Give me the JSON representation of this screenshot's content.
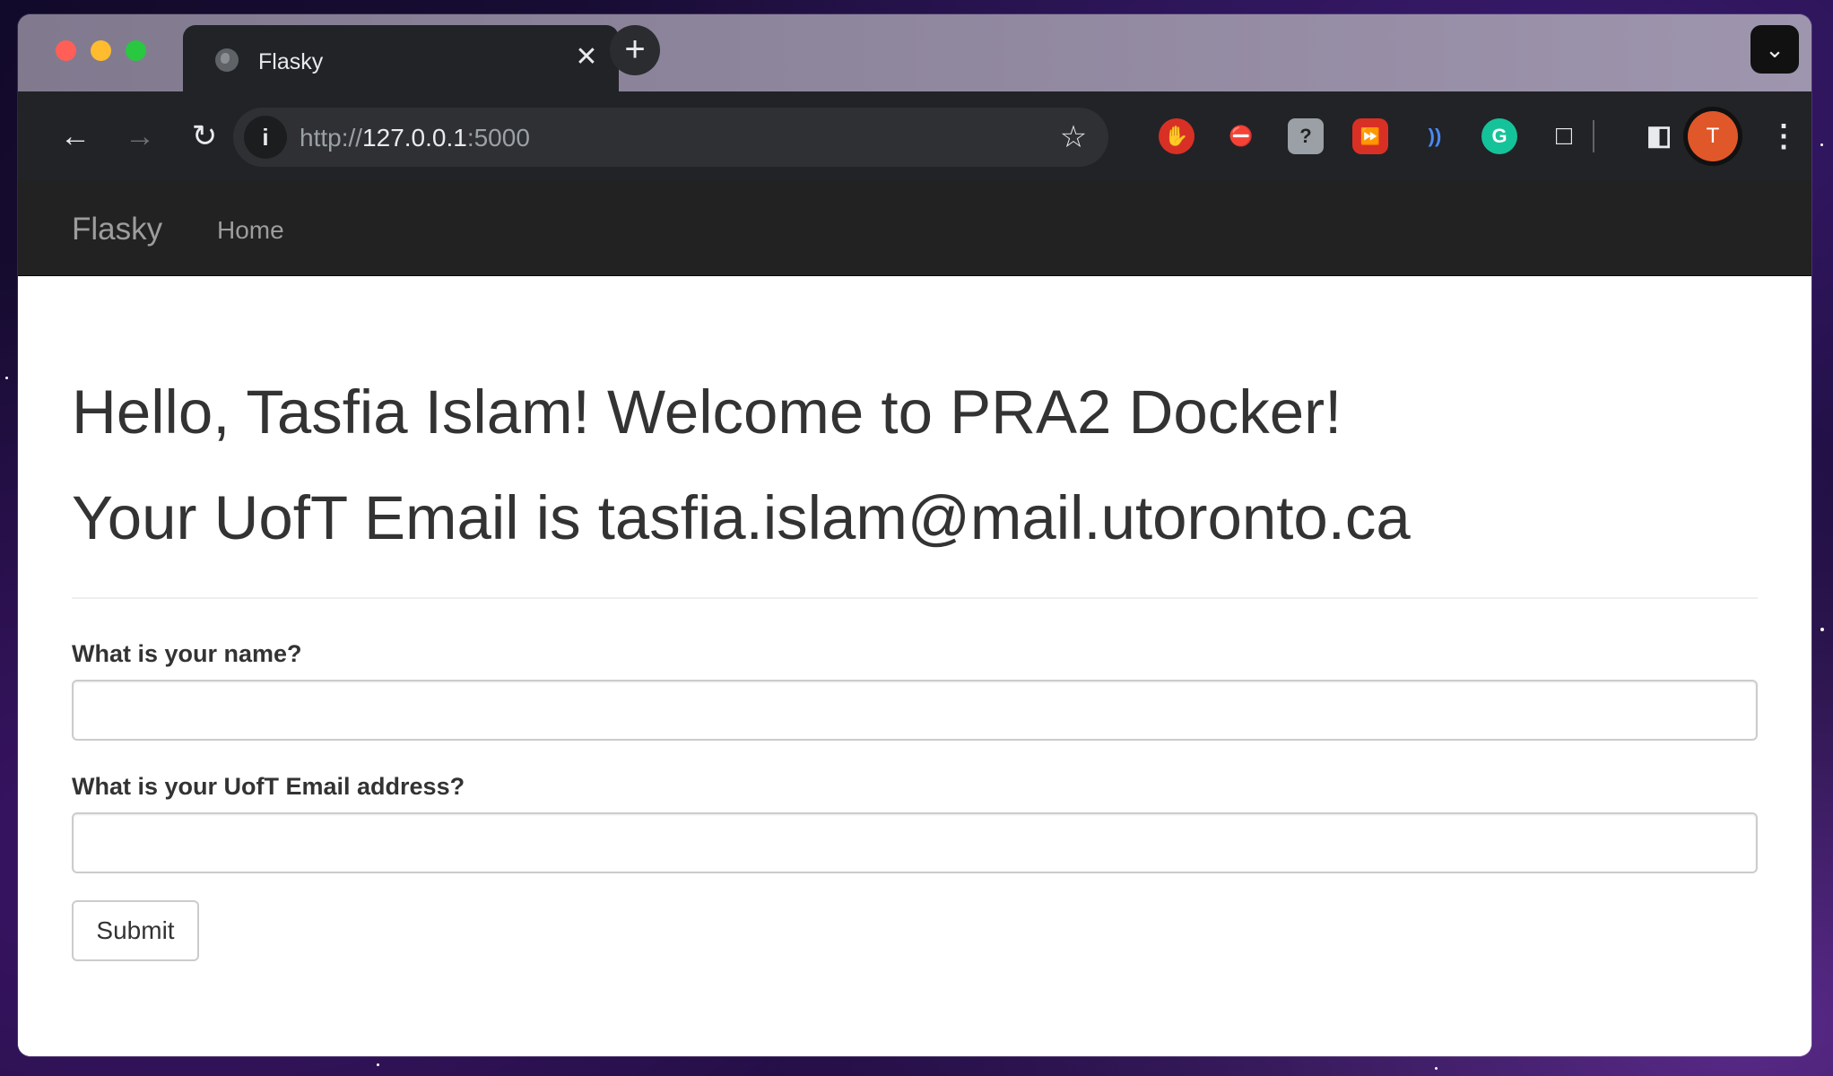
{
  "browser": {
    "tab_title": "Flasky",
    "tab_close": "✕",
    "new_tab": "+",
    "url_scheme": "http://",
    "url_host": "127.0.0.1",
    "url_port": ":5000",
    "profile_initial": "T",
    "extensions": [
      "hand-stop-icon",
      "shield-block-icon",
      "help-icon",
      "fast-forward-icon",
      "wave-icon",
      "grammarly-icon",
      "puzzle-icon"
    ]
  },
  "navbar": {
    "brand": "Flasky",
    "home": "Home"
  },
  "main": {
    "greeting": "Hello, Tasfia Islam! Welcome to PRA2 Docker!",
    "email_line": "Your UofT Email is tasfia.islam@mail.utoronto.ca"
  },
  "form": {
    "name_label": "What is your name?",
    "name_value": "",
    "email_label": "What is your UofT Email address?",
    "email_value": "",
    "submit_label": "Submit"
  },
  "colors": {
    "navbar_bg": "#222222",
    "avatar": "#e0572a",
    "text": "#333333"
  }
}
